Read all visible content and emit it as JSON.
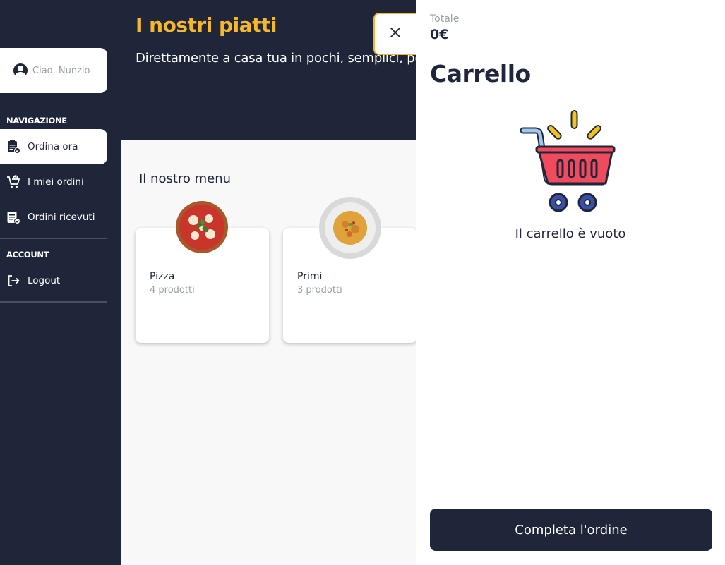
{
  "sidebar": {
    "user_greeting": "Ciao, Nunzio",
    "nav_section_title": "NAVIGAZIONE",
    "nav_items": [
      {
        "label": "Ordina ora",
        "icon": "clipboard-order-icon",
        "active": true
      },
      {
        "label": "I miei ordini",
        "icon": "cart-check-icon",
        "active": false
      },
      {
        "label": "Ordini ricevuti",
        "icon": "receipt-check-icon",
        "active": false
      }
    ],
    "account_section_title": "ACCOUNT",
    "logout_label": "Logout"
  },
  "header": {
    "title": "I nostri piatti",
    "subtitle": "Direttamente a casa tua in pochi, semplici, po"
  },
  "menu": {
    "title": "Il nostro menu",
    "categories": [
      {
        "name": "Pizza",
        "count": "4 prodotti"
      },
      {
        "name": "Primi",
        "count": "3 prodotti"
      }
    ]
  },
  "cart": {
    "total_label": "Totale",
    "total_value": "0€",
    "title": "Carrello",
    "empty_text": "Il carrello è vuoto",
    "complete_button": "Completa l'ordine"
  },
  "colors": {
    "navy": "#1f2639",
    "accent_yellow": "#f6b82a",
    "cart_red": "#ef4b5c",
    "muted_text": "#9a9ea8"
  }
}
